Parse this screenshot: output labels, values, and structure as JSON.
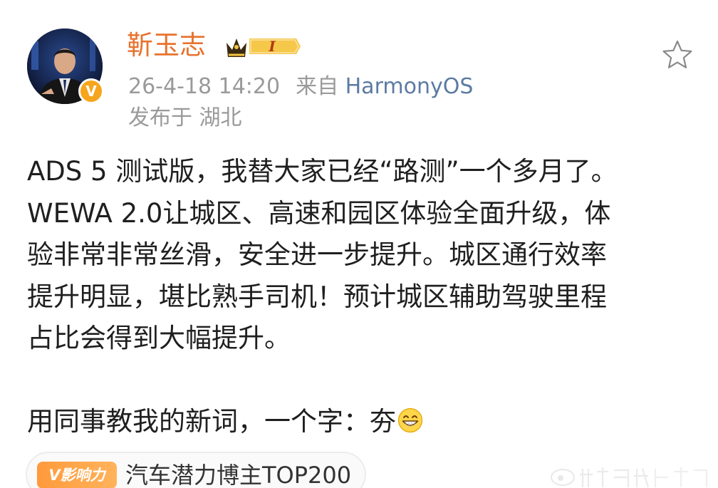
{
  "header": {
    "username": "靳玉志",
    "vip_level": "I",
    "verified_mark": "V",
    "timestamp": "26-4-18 14:20",
    "source_prefix": "来自",
    "source": "HarmonyOS",
    "location": "发布于 湖北"
  },
  "post": {
    "lines": [
      "ADS 5 测试版，我替大家已经“路测”一个多月了。",
      "WEWA 2.0让城区、高速和园区体验全面升级，体",
      "验非常非常丝滑，安全进一步提升。城区通行效率",
      "提升明显，堪比熟手司机！预计城区辅助驾驶里程",
      "占比会得到大幅提升。",
      "用同事教我的新词，一个字：夯"
    ]
  },
  "influence": {
    "badge": "V影响力",
    "label": "汽车潜力博主TOP200"
  },
  "icons": {
    "favorite": "star-icon",
    "crown": "crown-icon",
    "emoji": "grin-emoji-icon"
  },
  "colors": {
    "username": "#e8722d",
    "meta": "#9a9a9a",
    "link": "#5c7ba3",
    "verified": "#f7a51d",
    "badge": "#ff9a3c"
  }
}
